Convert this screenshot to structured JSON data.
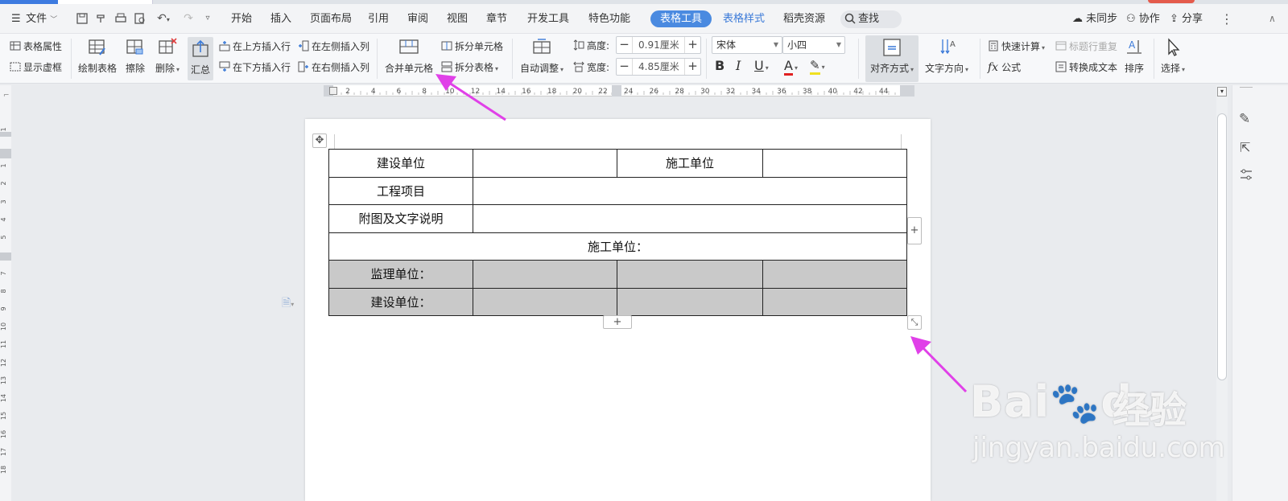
{
  "menu": {
    "file": "文件",
    "items": [
      "开始",
      "插入",
      "页面布局",
      "引用",
      "审阅",
      "视图",
      "章节",
      "开发工具",
      "特色功能"
    ],
    "active_tab": "表格工具",
    "table_style": "表格样式",
    "resource": "稻壳资源",
    "search": "查找",
    "sync": "未同步",
    "collab": "协作",
    "share": "分享"
  },
  "ribbon": {
    "table_props": "表格属性",
    "show_gridlines": "显示虚框",
    "draw_table": "绘制表格",
    "erase": "擦除",
    "delete": "删除",
    "summary": "汇总",
    "insert_above": "在上方插入行",
    "insert_below": "在下方插入行",
    "insert_left": "在左侧插入列",
    "insert_right": "在右侧插入列",
    "merge_cells": "合并单元格",
    "split_cells": "拆分单元格",
    "split_table": "拆分表格",
    "auto_fit": "自动调整",
    "height_label": "高度:",
    "height_value": "0.91厘米",
    "width_label": "宽度:",
    "width_value": "4.85厘米",
    "font_name": "宋体",
    "font_size": "小四",
    "bold": "B",
    "italic": "I",
    "underline": "U",
    "font_color": "A",
    "align": "对齐方式",
    "text_dir": "文字方向",
    "quick_calc": "快速计算",
    "formula": "公式",
    "repeat_header": "标题行重复",
    "to_text": "转换成文本",
    "sort": "排序",
    "select": "选择"
  },
  "ruler": {
    "numbers": [
      "2",
      "4",
      "6",
      "8",
      "10",
      "12",
      "14",
      "16",
      "18",
      "20",
      "22",
      "24",
      "26",
      "28",
      "30",
      "32",
      "34",
      "36",
      "38",
      "40",
      "42",
      "44"
    ]
  },
  "vruler": {
    "numbers": [
      "1",
      "1",
      "2",
      "3",
      "4",
      "5",
      "6",
      "7",
      "8",
      "9",
      "10",
      "11",
      "12",
      "13",
      "14",
      "15",
      "16",
      "17",
      "18"
    ]
  },
  "table": {
    "rows": [
      [
        "建设单位",
        "",
        "施工单位",
        ""
      ],
      [
        "工程项目",
        ""
      ],
      [
        "附图及文字说明",
        ""
      ],
      [
        "施工单位："
      ],
      [
        "监理单位：",
        "",
        "",
        ""
      ],
      [
        "建设单位：",
        "",
        "",
        ""
      ]
    ]
  },
  "watermark": {
    "brand": "Bai",
    "brand2": "du",
    "cn": "经验",
    "url": "jingyan.baidu.com"
  },
  "colors": {
    "accent": "#4a8ae0",
    "arrow": "#e040e8",
    "shade": "#c9c9c9"
  }
}
